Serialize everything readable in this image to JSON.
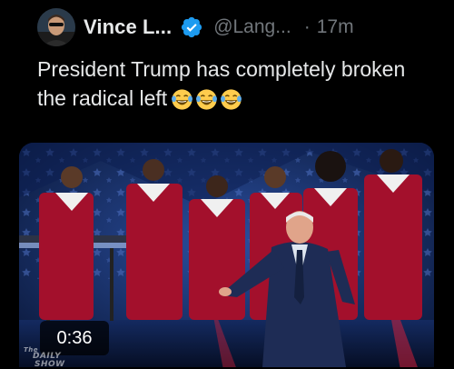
{
  "tweet": {
    "display_name": "Vince L...",
    "handle": "@Lang...",
    "separator": "·",
    "time": "17m",
    "text": "President Trump has completely broken the radical left",
    "emoji": [
      "face-with-tears-of-joy",
      "face-with-tears-of-joy",
      "face-with-tears-of-joy"
    ],
    "verified": true
  },
  "media": {
    "type": "video",
    "duration": "0:36",
    "watermark": "The Daily Show"
  },
  "colors": {
    "background": "#000000",
    "primary_text": "#e7e9ea",
    "secondary_text": "#71767b",
    "verified_blue": "#1d9bf0",
    "choir_robe": "#a3102c",
    "stage_blue": "#0b1c46"
  }
}
